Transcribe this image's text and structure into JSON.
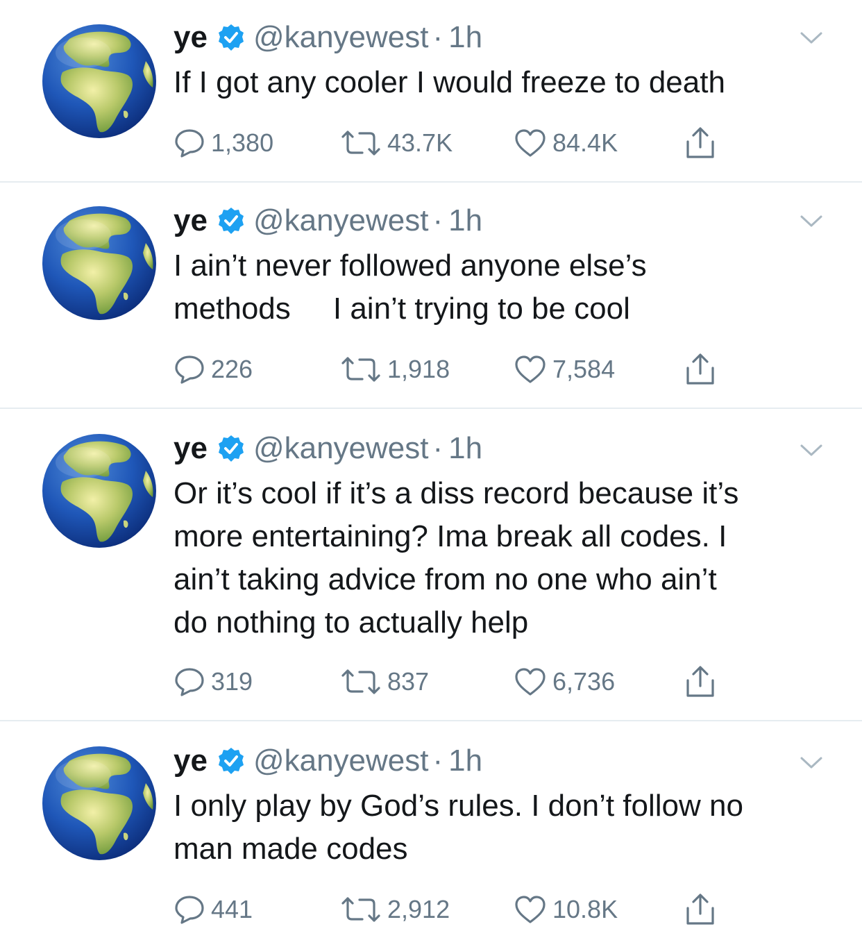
{
  "colors": {
    "text": "#14171a",
    "secondary": "#657786",
    "verified": "#1da1f2",
    "divider": "#e6ecf0"
  },
  "icons": {
    "avatar": "globe-africa-europe-emoji",
    "verified": "verified-badge-icon",
    "menu": "chevron-down-icon",
    "reply": "reply-icon",
    "retweet": "retweet-icon",
    "like": "heart-icon",
    "share": "share-icon"
  },
  "tweets": [
    {
      "name": "ye",
      "handle": "@kanyewest",
      "separator": "·",
      "time": "1h",
      "text": "If I got any cooler I would freeze to death",
      "replies": "1,380",
      "retweets": "43.7K",
      "likes": "84.4K"
    },
    {
      "name": "ye",
      "handle": "@kanyewest",
      "separator": "·",
      "time": "1h",
      "text": "I ain’t never followed anyone else’s\nmethods     I ain’t trying to be cool",
      "replies": "226",
      "retweets": "1,918",
      "likes": "7,584"
    },
    {
      "name": "ye",
      "handle": "@kanyewest",
      "separator": "·",
      "time": "1h",
      "text": "Or it’s cool if it’s a diss record because it’s\nmore entertaining? Ima break all codes. I\nain’t taking advice from no one who ain’t\ndo nothing to actually help",
      "replies": "319",
      "retweets": "837",
      "likes": "6,736"
    },
    {
      "name": "ye",
      "handle": "@kanyewest",
      "separator": "·",
      "time": "1h",
      "text": "I only play by God’s rules. I don’t follow no\nman made codes",
      "replies": "441",
      "retweets": "2,912",
      "likes": "10.8K"
    }
  ]
}
